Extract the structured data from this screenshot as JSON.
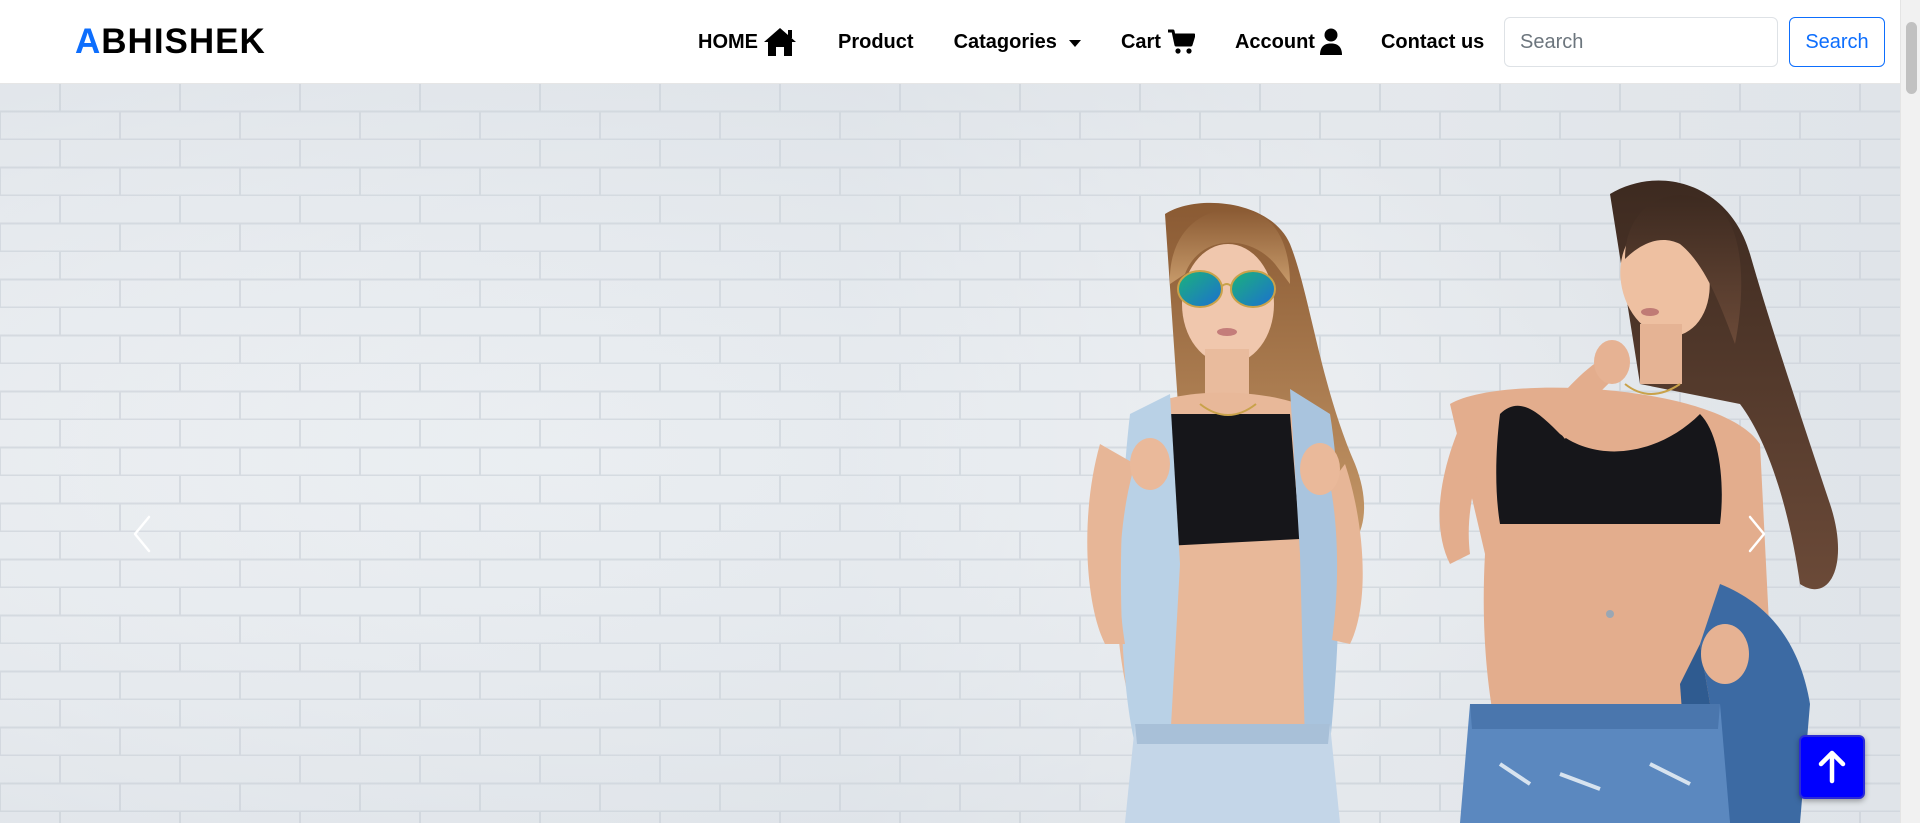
{
  "brand": {
    "first_letter": "A",
    "rest": "BHISHEK",
    "accent_color": "#0d6efd"
  },
  "nav": {
    "home": {
      "label": "HOME",
      "icon": "house-icon"
    },
    "product": {
      "label": "Product"
    },
    "categories": {
      "label": "Catagories",
      "icon": "caret-down-icon"
    },
    "cart": {
      "label": "Cart",
      "icon": "cart-icon"
    },
    "account": {
      "label": "Account",
      "icon": "user-icon"
    },
    "contact": {
      "label": "Contact us"
    }
  },
  "search": {
    "placeholder": "Search",
    "button_label": "Search",
    "button_color": "#0d6efd"
  },
  "carousel": {
    "image": "two women in crop tops and denim shorts leaning against a white brick wall",
    "prev_icon": "chevron-left-icon",
    "next_icon": "chevron-right-icon"
  },
  "back_to_top": {
    "icon": "arrow-up-icon",
    "color": "#0000ff"
  }
}
